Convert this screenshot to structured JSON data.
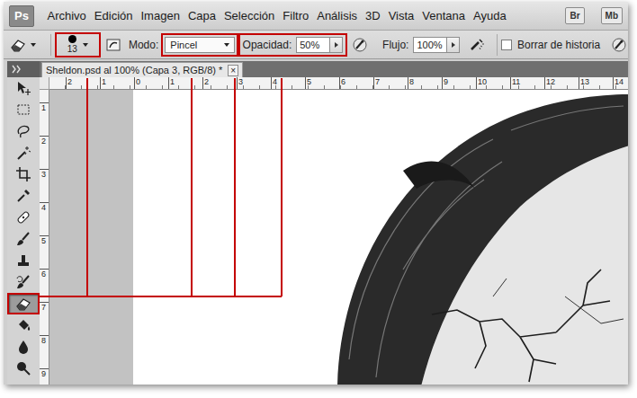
{
  "app": {
    "logo": "Ps",
    "menus": [
      "Archivo",
      "Edición",
      "Imagen",
      "Capa",
      "Selección",
      "Filtro",
      "Análisis",
      "3D",
      "Vista",
      "Ventana",
      "Ayuda"
    ],
    "badges": [
      "Br",
      "Mb"
    ]
  },
  "options_bar": {
    "brush": {
      "size": "13",
      "highlighted": true
    },
    "mode": {
      "label": "Modo:",
      "value": "Pincel",
      "highlighted": true
    },
    "opacity": {
      "label": "Opacidad:",
      "value": "50%",
      "highlighted": true
    },
    "flow": {
      "label": "Flujo:",
      "value": "100%",
      "highlighted": false
    },
    "erase_history": {
      "label": "Borrar de historia",
      "checked": false
    }
  },
  "tools": [
    {
      "selected": false,
      "highlighted": false
    },
    {
      "selected": false,
      "highlighted": false
    },
    {
      "selected": false,
      "highlighted": false
    },
    {
      "selected": false,
      "highlighted": false
    },
    {
      "selected": false,
      "highlighted": false
    },
    {
      "selected": false,
      "highlighted": false
    },
    {
      "selected": false,
      "highlighted": false
    },
    {
      "selected": false,
      "highlighted": false
    },
    {
      "selected": false,
      "highlighted": false
    },
    {
      "selected": false,
      "highlighted": false
    },
    {
      "selected": true,
      "highlighted": true
    },
    {
      "selected": false,
      "highlighted": false
    },
    {
      "selected": false,
      "highlighted": false
    },
    {
      "selected": false,
      "highlighted": false
    }
  ],
  "document": {
    "tab": {
      "title": "Sheldon.psd al 100% (Capa 3, RGB/8) *",
      "close": "×"
    },
    "ruler_top": [
      "2",
      "1",
      "0",
      "1",
      "2",
      "3",
      "4",
      "5",
      "6",
      "7",
      "8",
      "9",
      "10",
      "11",
      "12",
      "13",
      "14"
    ],
    "ruler_left": [
      "1",
      "2",
      "3",
      "4",
      "5",
      "6",
      "7",
      "8",
      "9"
    ]
  }
}
